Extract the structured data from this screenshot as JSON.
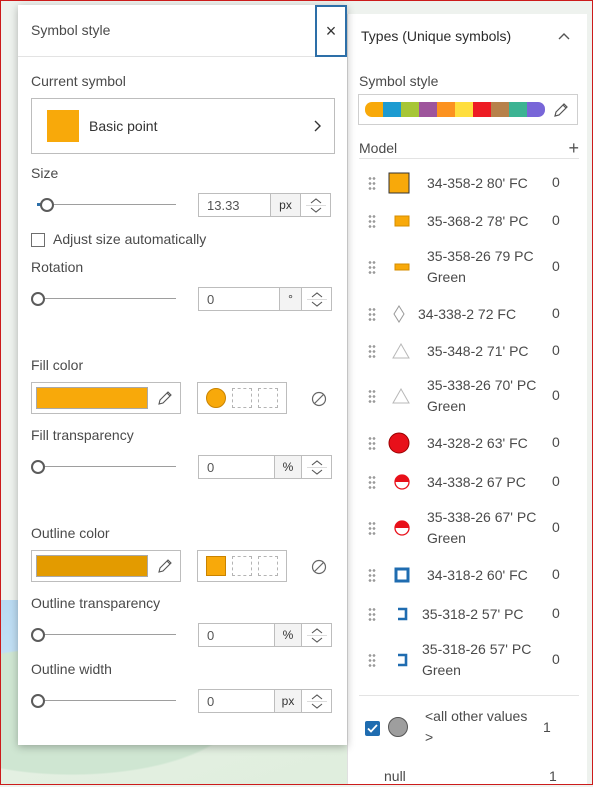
{
  "colors": {
    "accent": "#2d6fa8",
    "fill": "#f8a90a",
    "outline": "#e39b00",
    "red": "#e8101a",
    "blue": "#1f6cb0",
    "map_water": "#b9daf2"
  },
  "symbol_style_panel": {
    "title": "Symbol style",
    "close_glyph": "×",
    "current_symbol_label": "Current symbol",
    "current_symbol_name": "Basic point",
    "size_label": "Size",
    "size_value": "13.33",
    "size_unit": "px",
    "size_slider_fraction": 0.07,
    "adjust_size_label": "Adjust size automatically",
    "adjust_size_checked": false,
    "rotation_label": "Rotation",
    "rotation_value": "0",
    "rotation_unit": "°",
    "fill_color_label": "Fill color",
    "fill_transparency_label": "Fill transparency",
    "fill_transparency_value": "0",
    "fill_transparency_unit": "%",
    "outline_color_label": "Outline color",
    "outline_transparency_label": "Outline transparency",
    "outline_transparency_value": "0",
    "outline_transparency_unit": "%",
    "outline_width_label": "Outline width",
    "outline_width_value": "0",
    "outline_width_unit": "px"
  },
  "types_panel": {
    "title": "Types (Unique symbols)",
    "symbol_style_label": "Symbol style",
    "ramp_colors": [
      "#f8a90a",
      "#1d9bd1",
      "#a7c636",
      "#9e559c",
      "#fc921f",
      "#ffde3e",
      "#ed1c24",
      "#b7814a",
      "#3cb393",
      "#7866d8"
    ],
    "model_label": "Model",
    "add_glyph": "+",
    "categories": [
      {
        "line1": "34-358-2 80' FC",
        "line2": "",
        "count": "0",
        "symbol": "orange-square-large"
      },
      {
        "line1": "35-368-2 78' PC",
        "line2": "",
        "count": "0",
        "symbol": "orange-rect-small"
      },
      {
        "line1": "35-358-26 79 PC",
        "line2": "Green",
        "count": "0",
        "symbol": "orange-rect-flat"
      },
      {
        "line1": "34-338-2 72 FC",
        "line2": "",
        "count": "0",
        "symbol": "diamond-outline"
      },
      {
        "line1": "35-348-2 71' PC",
        "line2": "",
        "count": "0",
        "symbol": "triangle-outline"
      },
      {
        "line1": "35-338-26 70' PC",
        "line2": "Green",
        "count": "0",
        "symbol": "triangle-outline"
      },
      {
        "line1": "34-328-2 63' FC",
        "line2": "",
        "count": "0",
        "symbol": "red-circle"
      },
      {
        "line1": "34-338-2 67 PC",
        "line2": "",
        "count": "0",
        "symbol": "half-red-circle"
      },
      {
        "line1": "35-338-26 67' PC",
        "line2": "Green",
        "count": "0",
        "symbol": "half-red-circle"
      },
      {
        "line1": "34-318-2 60' FC",
        "line2": "",
        "count": "0",
        "symbol": "blue-square-outline"
      },
      {
        "line1": "35-318-2 57' PC",
        "line2": "",
        "count": "0",
        "symbol": "blue-bracket"
      },
      {
        "line1": "35-318-26 57' PC",
        "line2": "Green",
        "count": "0",
        "symbol": "blue-bracket"
      }
    ],
    "other_values_label": "<all other values >",
    "other_values_count": "1",
    "other_values_checked": true,
    "null_label": "null",
    "null_count": "1"
  }
}
